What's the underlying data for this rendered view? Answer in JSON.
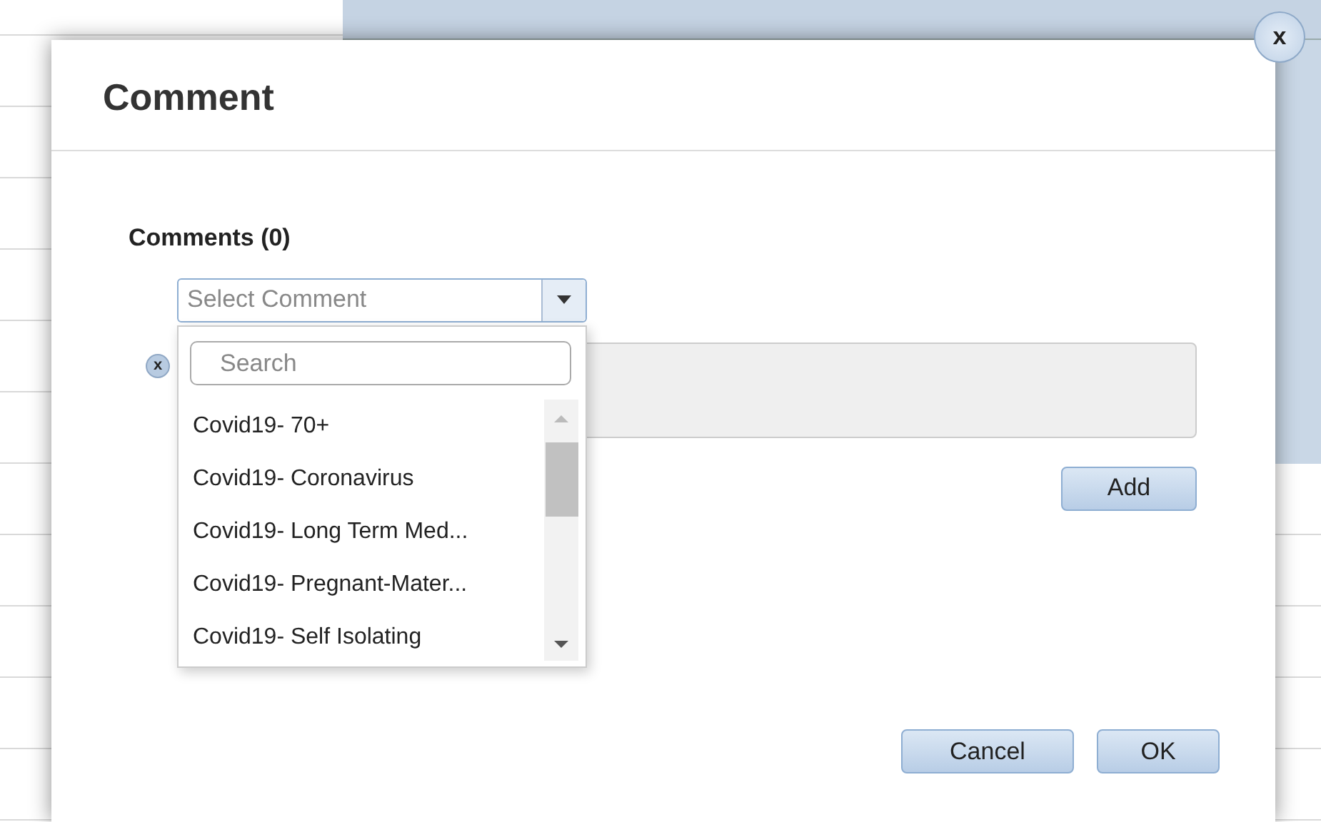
{
  "dialog": {
    "title": "Comment",
    "close_label": "x"
  },
  "comments": {
    "heading": "Comments (0)",
    "select": {
      "placeholder": "Select Comment",
      "expanded": true
    },
    "search": {
      "placeholder": "Search"
    },
    "options": [
      {
        "label": "Covid19- 70+"
      },
      {
        "label": "Covid19- Coronavirus"
      },
      {
        "label": "Covid19- Long Term Med..."
      },
      {
        "label": "Covid19- Pregnant-Mater..."
      },
      {
        "label": "Covid19- Self Isolating"
      }
    ],
    "clear_label": "x",
    "add_button": "Add"
  },
  "buttons": [
    "Cancel",
    "OK"
  ]
}
